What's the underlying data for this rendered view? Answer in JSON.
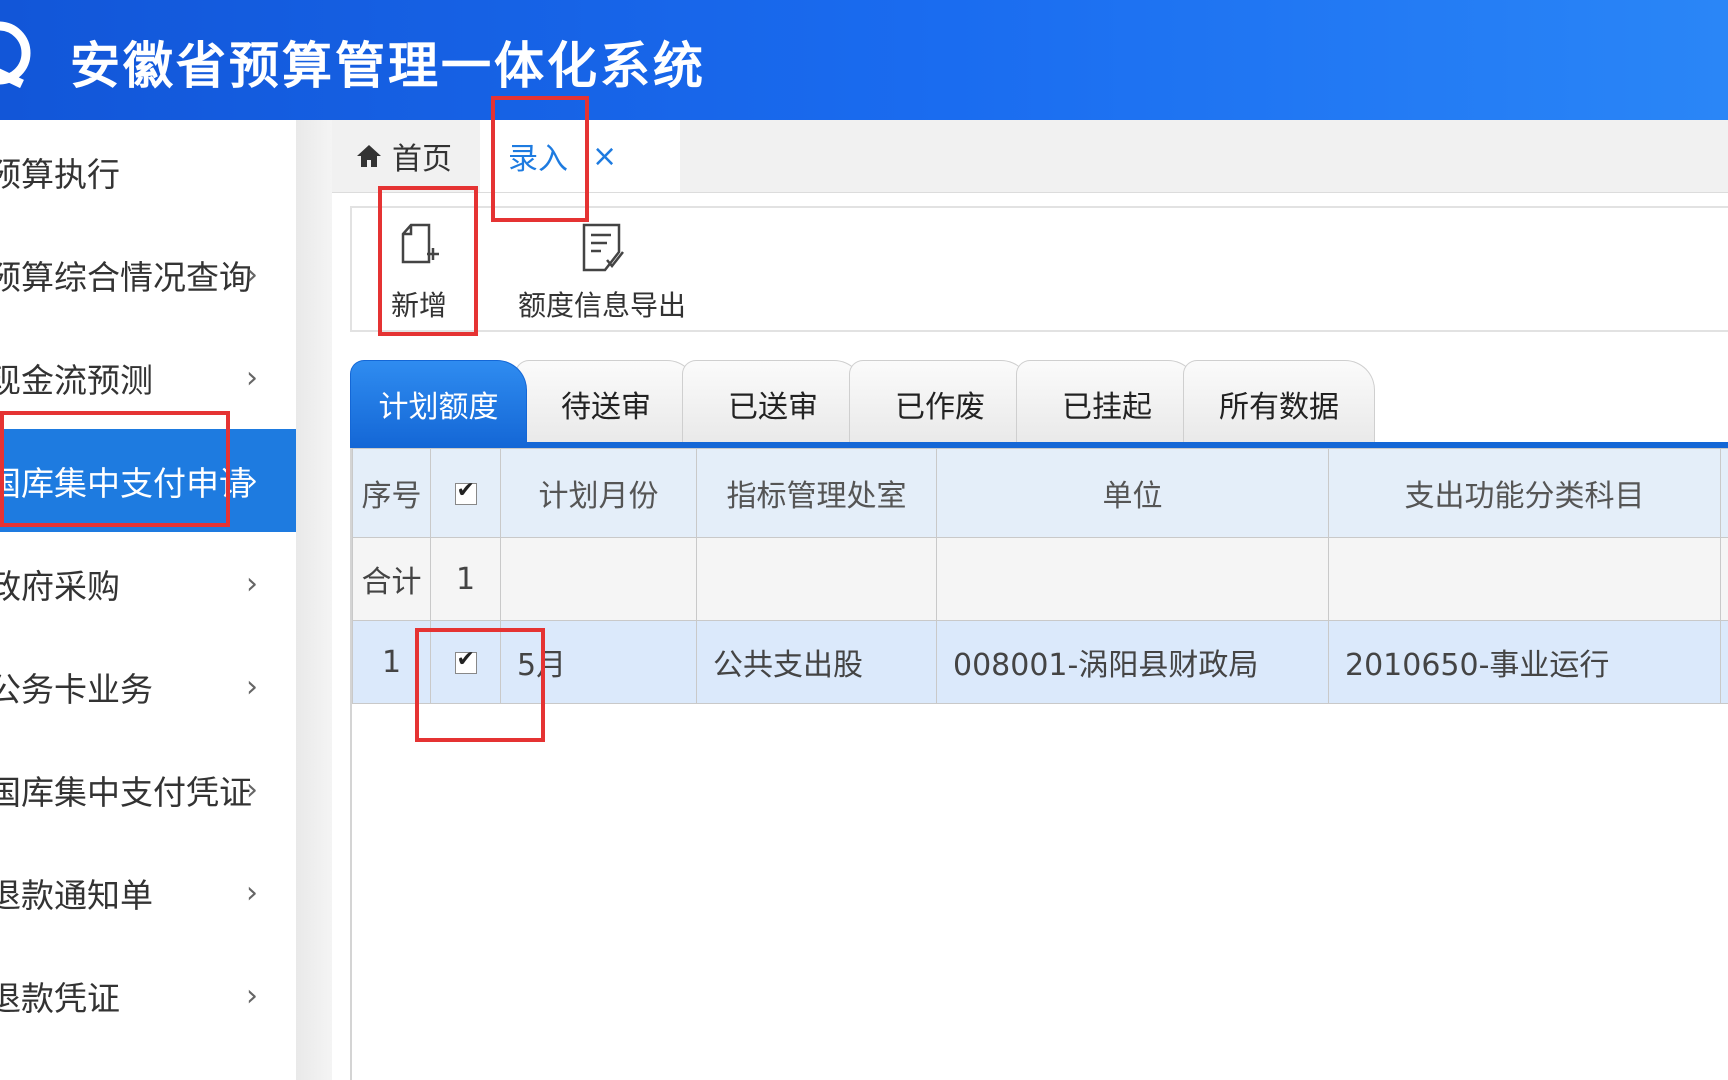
{
  "header": {
    "title": "安徽省预算管理一体化系统",
    "logo_icon": "swirl-logo-icon"
  },
  "sidebar": {
    "items": [
      {
        "label": "预算执行",
        "has_chevron": false
      },
      {
        "label": "预算综合情况查询",
        "has_chevron": true
      },
      {
        "label": "现金流预测",
        "has_chevron": true
      },
      {
        "label": "国库集中支付申请",
        "has_chevron": true,
        "active": true
      },
      {
        "label": "政府采购",
        "has_chevron": true
      },
      {
        "label": "公务卡业务",
        "has_chevron": true
      },
      {
        "label": "国库集中支付凭证",
        "has_chevron": true
      },
      {
        "label": "退款通知单",
        "has_chevron": true
      },
      {
        "label": "退款凭证",
        "has_chevron": true
      }
    ],
    "chevron": "›"
  },
  "tabs": {
    "home_label": "首页",
    "entry_label": "录入",
    "close_glyph": "×"
  },
  "toolbar": {
    "add_label": "新增",
    "export_label": "额度信息导出"
  },
  "status_tabs": [
    "计划额度",
    "待送审",
    "已送审",
    "已作废",
    "已挂起",
    "所有数据"
  ],
  "table": {
    "columns": [
      "序号",
      "计划月份",
      "指标管理处室",
      "单位",
      "支出功能分类科目"
    ],
    "summary": {
      "label": "合计",
      "count": "1"
    },
    "rows": [
      {
        "index": "1",
        "month": "5月",
        "office": "公共支出股",
        "unit": "008001-涡阳县财政局",
        "function_code": "2010650-事业运行",
        "checked": true
      }
    ]
  },
  "colors": {
    "header_blue": "#1a6cf0",
    "active_blue": "#1e7be0",
    "annotation_red": "#e53333",
    "selected_row": "#dbe9fb"
  }
}
